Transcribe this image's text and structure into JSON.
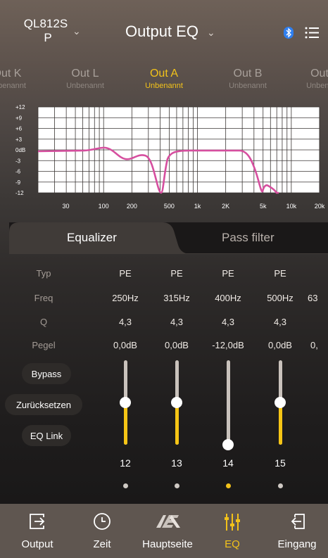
{
  "header": {
    "device_line1": "QL812S",
    "device_line2": "P",
    "title": "Output EQ",
    "chevron": "⌄",
    "icons": [
      "bluetooth-icon",
      "menu-icon"
    ]
  },
  "channels": [
    {
      "name": "Out K",
      "sub": "Unbenannt"
    },
    {
      "name": "Out L",
      "sub": "Unbenannt"
    },
    {
      "name": "Out A",
      "sub": "Unbenannt",
      "active": true
    },
    {
      "name": "Out B",
      "sub": "Unbenannt"
    },
    {
      "name": "Out C",
      "sub": "Unbenannt"
    }
  ],
  "graph": {
    "y_ticks": [
      "+12",
      "+9",
      "+6",
      "+3",
      "0dB",
      "-3",
      "-6",
      "-9",
      "-12"
    ],
    "x_ticks": [
      "30",
      "100",
      "200",
      "500",
      "1k",
      "2K",
      "5k",
      "10k",
      "20k"
    ],
    "curve_color": "#d64f9f"
  },
  "tabs": {
    "equalizer": "Equalizer",
    "pass_filter": "Pass filter"
  },
  "row_labels": {
    "type": "Typ",
    "freq": "Freq",
    "q": "Q",
    "level": "Pegel"
  },
  "bands": [
    {
      "type": "PE",
      "freq": "250Hz",
      "q": "4,3",
      "level": "0,0dB",
      "number": "12",
      "gain_db": 0,
      "selected": false
    },
    {
      "type": "PE",
      "freq": "315Hz",
      "q": "4,3",
      "level": "0,0dB",
      "number": "13",
      "gain_db": 0,
      "selected": false
    },
    {
      "type": "PE",
      "freq": "400Hz",
      "q": "4,3",
      "level": "-12,0dB",
      "number": "14",
      "gain_db": -12,
      "selected": true
    },
    {
      "type": "PE",
      "freq": "500Hz",
      "q": "4,3",
      "level": "0,0dB",
      "number": "15",
      "gain_db": 0,
      "selected": false
    },
    {
      "type": "",
      "freq": "63",
      "q": "",
      "level": "0,",
      "number": "",
      "gain_db": 0,
      "selected": false
    }
  ],
  "buttons": {
    "bypass": "Bypass",
    "reset": "Zurücksetzen",
    "eq_link": "EQ Link"
  },
  "nav": [
    {
      "label": "Output",
      "icon": "output-icon"
    },
    {
      "label": "Zeit",
      "icon": "clock-icon"
    },
    {
      "label": "Hauptseite",
      "icon": "esx-logo-icon"
    },
    {
      "label": "EQ",
      "icon": "eq-sliders-icon",
      "active": true
    },
    {
      "label": "Eingang",
      "icon": "input-icon"
    }
  ],
  "colors": {
    "accent": "#f2c21a",
    "nav_bg": "#5f5650"
  }
}
